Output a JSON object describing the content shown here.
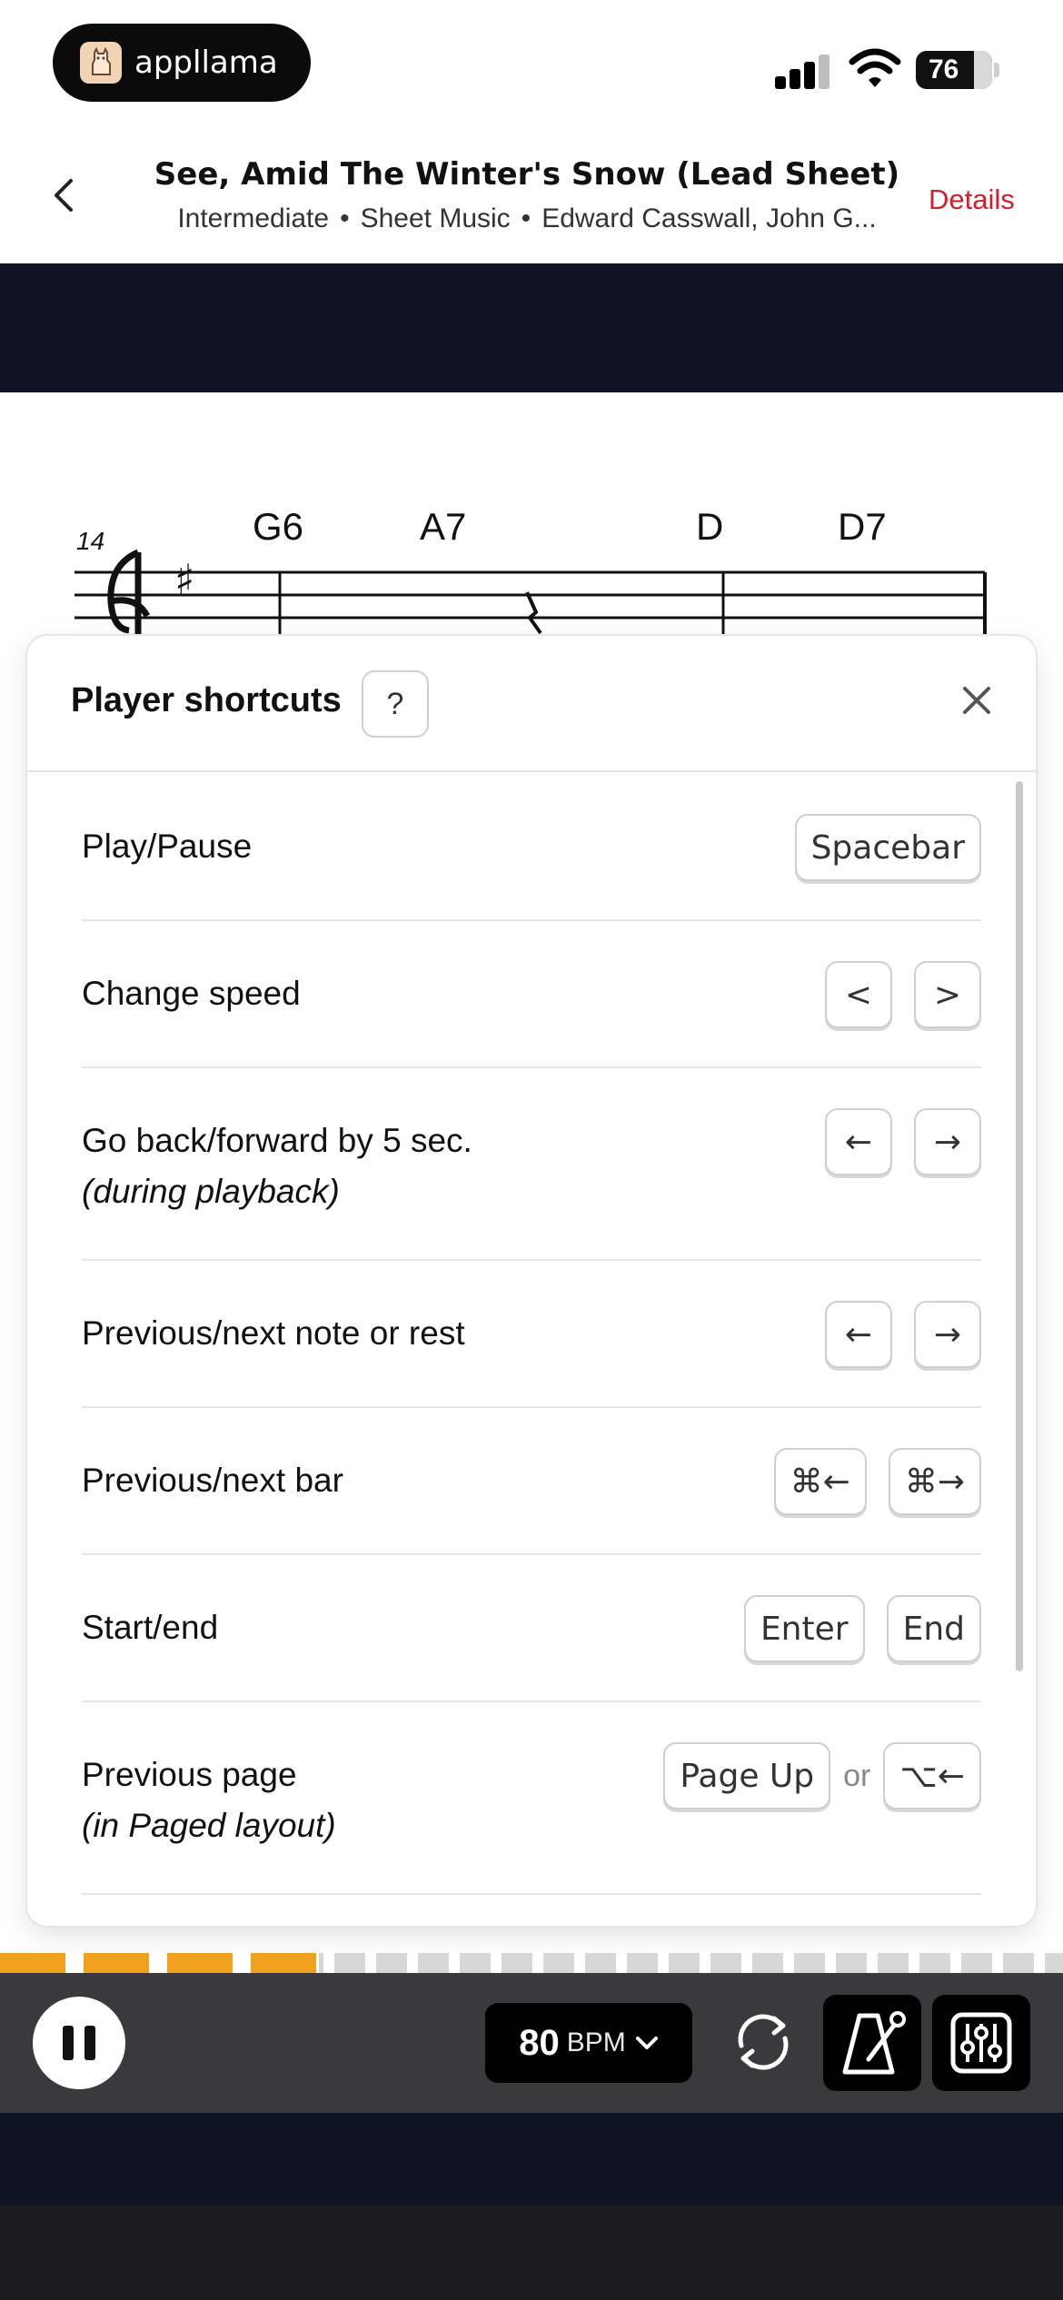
{
  "status_bar": {
    "app_name": "appllama",
    "battery": "76",
    "logo_icon": "llama-icon",
    "signal_icon": "cellular-signal-icon",
    "wifi_icon": "wifi-icon"
  },
  "header": {
    "title": "See, Amid The Winter's Snow (Lead Sheet)",
    "subtitle_level": "Intermediate",
    "subtitle_type": "Sheet Music",
    "subtitle_authors": "Edward Casswall, John G...",
    "subtitle_separator": "•",
    "details_label": "Details",
    "details_color": "#d0202e"
  },
  "sheet": {
    "bar_number": "14",
    "chords": [
      "G6",
      "A7",
      "D",
      "D7"
    ]
  },
  "modal": {
    "title": "Player shortcuts",
    "help_label": "?",
    "rows": [
      {
        "label": "Play/Pause",
        "sub": "",
        "keys": [
          "Spacebar"
        ]
      },
      {
        "label": "Change speed",
        "sub": "",
        "keys": [
          "<",
          ">"
        ]
      },
      {
        "label": "Go back/forward by 5 sec.",
        "sub": "(during playback)",
        "keys": [
          "←",
          "→"
        ]
      },
      {
        "label": "Previous/next note or rest",
        "sub": "",
        "keys": [
          "←",
          "→"
        ]
      },
      {
        "label": "Previous/next bar",
        "sub": "",
        "keys": [
          "⌘←",
          "⌘→"
        ]
      },
      {
        "label": "Start/end",
        "sub": "",
        "keys": [
          "Enter",
          "End"
        ]
      },
      {
        "label": "Previous page",
        "sub": "(in Paged layout)",
        "keys": [
          "Page Up",
          "⌥←"
        ],
        "separator": "or"
      }
    ]
  },
  "player": {
    "progress_fraction": 0.3,
    "progress_color": "#f0a21e",
    "bpm_value": "80",
    "bpm_unit": "BPM"
  }
}
